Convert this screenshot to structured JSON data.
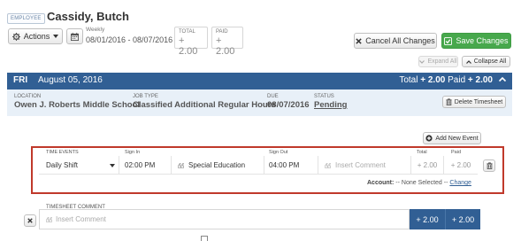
{
  "header": {
    "badge": "EMPLOYEE",
    "employee_name": "Cassidy, Butch",
    "actions_label": "Actions",
    "period_label": "Weekly",
    "period_range": "08/01/2016 - 08/07/2016",
    "total_label": "TOTAL",
    "total_value": "+ 2.00",
    "paid_label": "PAID",
    "paid_value": "+ 2.00",
    "cancel_label": "Cancel All Changes",
    "save_label": "Save Changes",
    "expand_label": "Expand All",
    "collapse_label": "Collapse All"
  },
  "day": {
    "abbr": "FRI",
    "date": "August 05, 2016",
    "total_prefix": "Total",
    "total_value": "+ 2.00",
    "paid_prefix": "Paid",
    "paid_value": "+ 2.00"
  },
  "info": {
    "location_label": "LOCATION",
    "location_value": "Owen J. Roberts Middle School",
    "jobtype_label": "JOB TYPE",
    "jobtype_value": "Classified Additional Regular Hours",
    "due_label": "DUE",
    "due_value": "08/07/2016",
    "status_label": "STATUS",
    "status_value": "Pending",
    "delete_label": "Delete Timesheet"
  },
  "events": {
    "add_label": "Add New Event",
    "section_label": "TIME EVENTS",
    "sign_in_label": "Sign In",
    "sign_out_label": "Sign Out",
    "total_label": "Total",
    "paid_label": "Paid",
    "rows": [
      {
        "type": "Daily Shift",
        "sign_in": "02:00 PM",
        "sign_in_comment": "Special Education",
        "sign_out": "04:00 PM",
        "sign_out_comment_placeholder": "Insert Comment",
        "total": "+ 2.00",
        "paid": "+ 2.00"
      }
    ],
    "account_label": "Account:",
    "account_value": "-- None Selected --",
    "change_label": "Change"
  },
  "comment": {
    "label": "TIMESHEET COMMENT",
    "placeholder": "Insert Comment",
    "total": "+ 2.00",
    "paid": "+ 2.00"
  },
  "colors": {
    "primary": "#315f94",
    "success": "#47a84c",
    "highlight": "#c0392b"
  }
}
